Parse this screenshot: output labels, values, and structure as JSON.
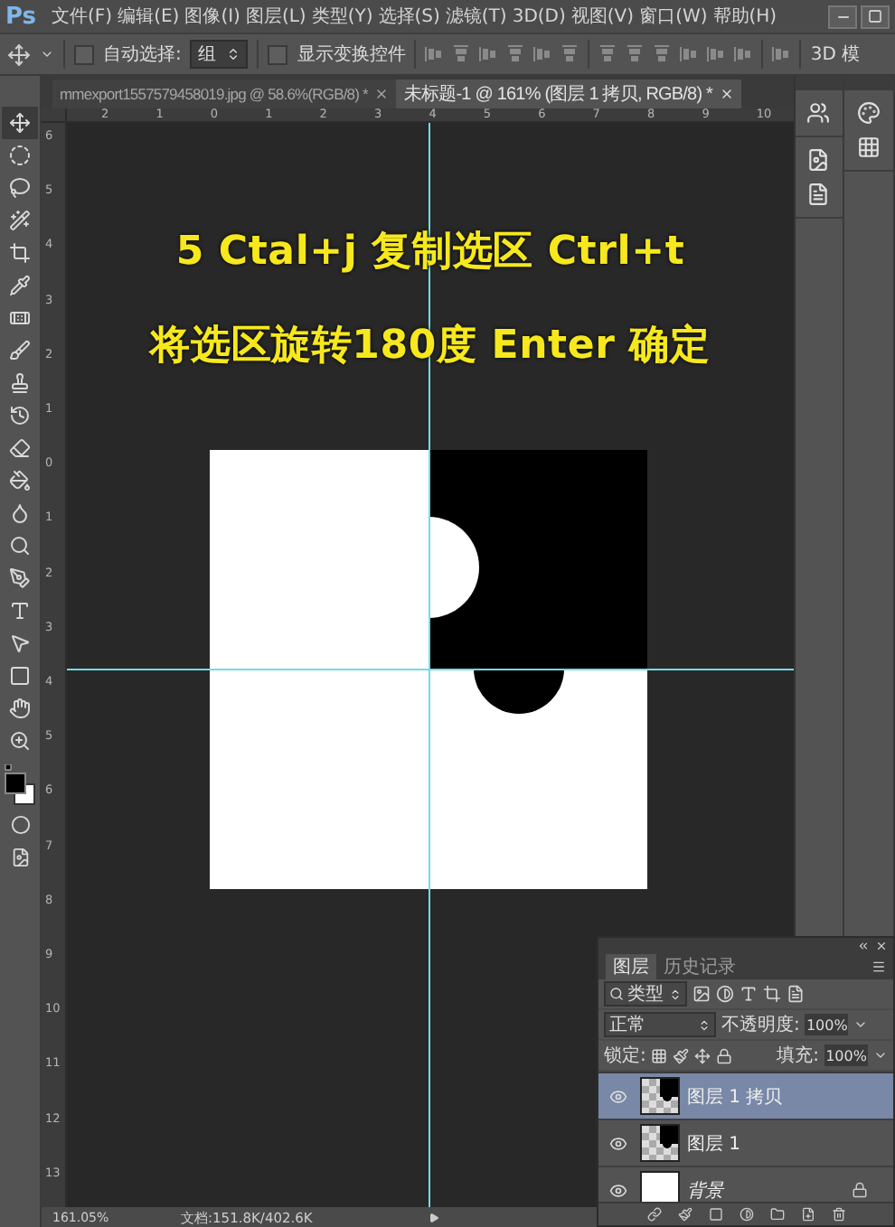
{
  "app": {
    "logo": "Ps"
  },
  "menu": [
    "文件(F)",
    "编辑(E)",
    "图像(I)",
    "图层(L)",
    "类型(Y)",
    "选择(S)",
    "滤镜(T)",
    "3D(D)",
    "视图(V)",
    "窗口(W)",
    "帮助(H)"
  ],
  "options_bar": {
    "auto_select": {
      "label": "自动选择:",
      "checked": false
    },
    "target": {
      "value": "组"
    },
    "show_transform": {
      "label": "显示变换控件",
      "checked": false
    },
    "mode_label": "3D 模"
  },
  "tabs": [
    {
      "label": "mmexport1557579458019.jpg @ 58.6%(RGB/8) *",
      "selected": false
    },
    {
      "label": "未标题-1 @ 161% (图层 1 拷贝, RGB/8) *",
      "selected": true
    }
  ],
  "tools": [
    {
      "kind": "move",
      "selected": true
    },
    {
      "kind": "ellipse",
      "selected": false
    },
    {
      "kind": "lasso",
      "selected": false
    },
    {
      "kind": "wand",
      "selected": false
    },
    {
      "kind": "crop",
      "selected": false
    },
    {
      "kind": "eyedropper",
      "selected": false
    },
    {
      "kind": "heal",
      "selected": false
    },
    {
      "kind": "brush",
      "selected": false
    },
    {
      "kind": "stamp",
      "selected": false
    },
    {
      "kind": "history",
      "selected": false
    },
    {
      "kind": "eraser",
      "selected": false
    },
    {
      "kind": "bucket",
      "selected": false
    },
    {
      "kind": "blur",
      "selected": false
    },
    {
      "kind": "dodge",
      "selected": false
    },
    {
      "kind": "pen",
      "selected": false
    },
    {
      "kind": "type",
      "selected": false
    },
    {
      "kind": "select",
      "selected": false
    },
    {
      "kind": "rect",
      "selected": false
    },
    {
      "kind": "hand",
      "selected": false
    },
    {
      "kind": "zoom",
      "selected": false
    }
  ],
  "rulers": {
    "horizontal": [
      "2",
      "1",
      "0",
      "1",
      "2",
      "3",
      "4",
      "5",
      "6",
      "7",
      "8",
      "9",
      "10"
    ],
    "vertical": [
      "6",
      "5",
      "4",
      "3",
      "2",
      "1",
      "0",
      "1",
      "2",
      "3",
      "4",
      "5",
      "6",
      "7",
      "8",
      "9",
      "10",
      "11",
      "12",
      "13"
    ]
  },
  "canvas": {
    "caption_lines": [
      "5 Ctal+j 复制选区 Ctrl+t",
      "将选区旋转180度 Enter 确定"
    ]
  },
  "status_bar": {
    "zoom": "161.05%",
    "doc_size": "文档:151.8K/402.6K"
  },
  "layers_panel": {
    "tabs": [
      {
        "label": "图层",
        "selected": true
      },
      {
        "label": "历史记录",
        "selected": false
      }
    ],
    "filter": "类型",
    "blend_mode": "正常",
    "opacity_label": "不透明度:",
    "opacity": "100%",
    "lock_label": "锁定:",
    "fill_label": "填充:",
    "fill": "100%",
    "layers": [
      {
        "name": "图层 1 拷贝",
        "selected": true,
        "visible": true,
        "kind": "piece"
      },
      {
        "name": "图层 1",
        "selected": false,
        "visible": true,
        "kind": "piece"
      },
      {
        "name": "背景",
        "selected": false,
        "visible": true,
        "kind": "background",
        "locked": true
      }
    ]
  }
}
